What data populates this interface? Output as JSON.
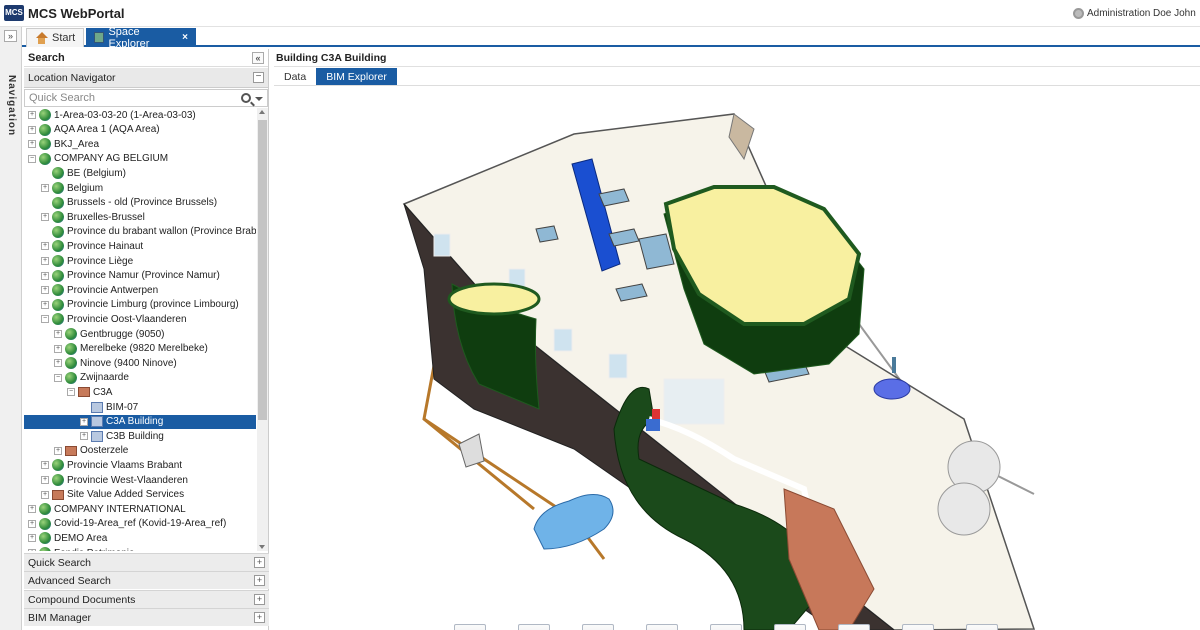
{
  "app": {
    "logo": "MCS",
    "title": "MCS WebPortal",
    "admin_label": "Administration",
    "user": "Doe John"
  },
  "tabs": [
    {
      "label": "Start",
      "icon": "home-icon"
    },
    {
      "label": "Space Explorer",
      "icon": "map-icon"
    }
  ],
  "nav_strip": {
    "label": "Navigation"
  },
  "sidebar": {
    "search_title": "Search",
    "location_navigator": "Location Navigator",
    "quick_search_placeholder": "Quick Search",
    "tree": [
      {
        "label": "1-Area-03-03-20 (1-Area-03-03)",
        "level": 0,
        "icon": "globe",
        "exp": "+"
      },
      {
        "label": "AQA Area 1 (AQA Area)",
        "level": 0,
        "icon": "globe",
        "exp": "+"
      },
      {
        "label": "BKJ_Area",
        "level": 0,
        "icon": "globe",
        "exp": "+"
      },
      {
        "label": "COMPANY AG BELGIUM",
        "level": 0,
        "icon": "globe",
        "exp": "-"
      },
      {
        "label": "BE (Belgium)",
        "level": 1,
        "icon": "globe",
        "exp": ""
      },
      {
        "label": "Belgium",
        "level": 1,
        "icon": "globe",
        "exp": "+"
      },
      {
        "label": "Brussels - old (Province Brussels)",
        "level": 1,
        "icon": "globe",
        "exp": ""
      },
      {
        "label": "Bruxelles-Brussel",
        "level": 1,
        "icon": "globe",
        "exp": "+"
      },
      {
        "label": "Province du brabant wallon (Province Brabant)",
        "level": 1,
        "icon": "globe",
        "exp": ""
      },
      {
        "label": "Province Hainaut",
        "level": 1,
        "icon": "globe",
        "exp": "+"
      },
      {
        "label": "Province Liège",
        "level": 1,
        "icon": "globe",
        "exp": "+"
      },
      {
        "label": "Province Namur (Province Namur)",
        "level": 1,
        "icon": "globe",
        "exp": "+"
      },
      {
        "label": "Provincie Antwerpen",
        "level": 1,
        "icon": "globe",
        "exp": "+"
      },
      {
        "label": "Provincie Limburg (province Limbourg)",
        "level": 1,
        "icon": "globe",
        "exp": "+"
      },
      {
        "label": "Provincie Oost-Vlaanderen",
        "level": 1,
        "icon": "globe",
        "exp": "-"
      },
      {
        "label": "Gentbrugge (9050)",
        "level": 2,
        "icon": "globe",
        "exp": "+"
      },
      {
        "label": "Merelbeke (9820 Merelbeke)",
        "level": 2,
        "icon": "globe",
        "exp": "+"
      },
      {
        "label": "Ninove (9400 Ninove)",
        "level": 2,
        "icon": "globe",
        "exp": "+"
      },
      {
        "label": "Zwijnaarde",
        "level": 2,
        "icon": "globe",
        "exp": "-"
      },
      {
        "label": "C3A",
        "level": 3,
        "icon": "brick",
        "exp": "-"
      },
      {
        "label": "BIM-07",
        "level": 4,
        "icon": "bldg",
        "exp": ""
      },
      {
        "label": "C3A Building",
        "level": 4,
        "icon": "bldg",
        "exp": "+",
        "selected": true
      },
      {
        "label": "C3B Building",
        "level": 4,
        "icon": "bldg",
        "exp": "+"
      },
      {
        "label": "Oosterzele",
        "level": 2,
        "icon": "brick",
        "exp": "+"
      },
      {
        "label": "Provincie Vlaams Brabant",
        "level": 1,
        "icon": "globe",
        "exp": "+"
      },
      {
        "label": "Provincie West-Vlaanderen",
        "level": 1,
        "icon": "globe",
        "exp": "+"
      },
      {
        "label": "Site Value Added Services",
        "level": 1,
        "icon": "brick",
        "exp": "+"
      },
      {
        "label": "COMPANY INTERNATIONAL",
        "level": 0,
        "icon": "globe",
        "exp": "+"
      },
      {
        "label": "Covid-19-Area_ref (Kovid-19-Area_ref)",
        "level": 0,
        "icon": "globe",
        "exp": "+"
      },
      {
        "label": "DEMO Area",
        "level": 0,
        "icon": "globe",
        "exp": "+"
      },
      {
        "label": "Fondis Patrimonia",
        "level": 0,
        "icon": "globe",
        "exp": "+"
      }
    ],
    "accordion": [
      "Quick Search",
      "Advanced Search",
      "Compound Documents",
      "BIM Manager"
    ]
  },
  "main": {
    "title": "Building C3A Building",
    "subtabs": [
      "Data",
      "BIM Explorer"
    ],
    "active_subtab": "BIM Explorer"
  },
  "toolbar": [
    "show-icon",
    "hide-icon",
    "section-icon",
    "rotate-icon",
    "cube-view-icon",
    "puzzle-icon",
    "info-icon",
    "zoom-icon",
    "helmet-icon"
  ],
  "colors": {
    "accent": "#1a5ca3",
    "roof": "#f4efd8",
    "wall": "#3b3230",
    "glass_frame": "#1f5a1f",
    "solar": "#1a4fd1",
    "floor_yellow": "#f8f0a0"
  }
}
